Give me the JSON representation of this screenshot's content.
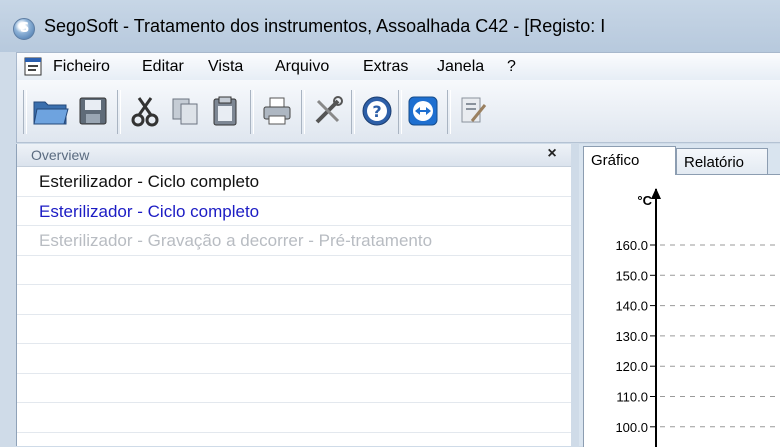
{
  "window": {
    "title": "SegoSoft - Tratamento dos instrumentos, Assoalhada C42 - [Registo: I"
  },
  "menu": {
    "items": [
      "Ficheiro",
      "Editar",
      "Vista",
      "Arquivo",
      "Extras",
      "Janela",
      "?"
    ]
  },
  "toolbar": {
    "buttons": [
      "open-folder-icon",
      "save-icon",
      "cut-icon",
      "copy-icon",
      "paste-icon",
      "print-icon",
      "settings-tools-icon",
      "help-icon",
      "remote-connect-icon",
      "document-edit-icon"
    ]
  },
  "overview": {
    "title": "Overview",
    "close_label": "×",
    "rows": [
      {
        "text": "Esterilizador - Ciclo completo",
        "state": "normal"
      },
      {
        "text": "Esterilizador - Ciclo completo",
        "state": "selected"
      },
      {
        "text": "Esterilizador - Gravação a decorrer - Pré-tratamento",
        "state": "disabled"
      },
      {
        "text": "",
        "state": "normal"
      },
      {
        "text": "",
        "state": "normal"
      },
      {
        "text": "",
        "state": "normal"
      },
      {
        "text": "",
        "state": "normal"
      },
      {
        "text": "",
        "state": "normal"
      },
      {
        "text": "",
        "state": "normal"
      }
    ]
  },
  "tabs": {
    "grafico": "Gráfico",
    "relatorio": "Relatório"
  },
  "chart_data": {
    "type": "line",
    "ylabel": "°C",
    "y_ticks": [
      "160.0",
      "150.0",
      "140.0",
      "130.0",
      "120.0",
      "110.0",
      "100.0"
    ],
    "grid": true,
    "series": []
  },
  "colors": {
    "selected_text": "#1c1cc4",
    "disabled_text": "#b8bcc2",
    "titlebar": "#c0d1e4"
  }
}
